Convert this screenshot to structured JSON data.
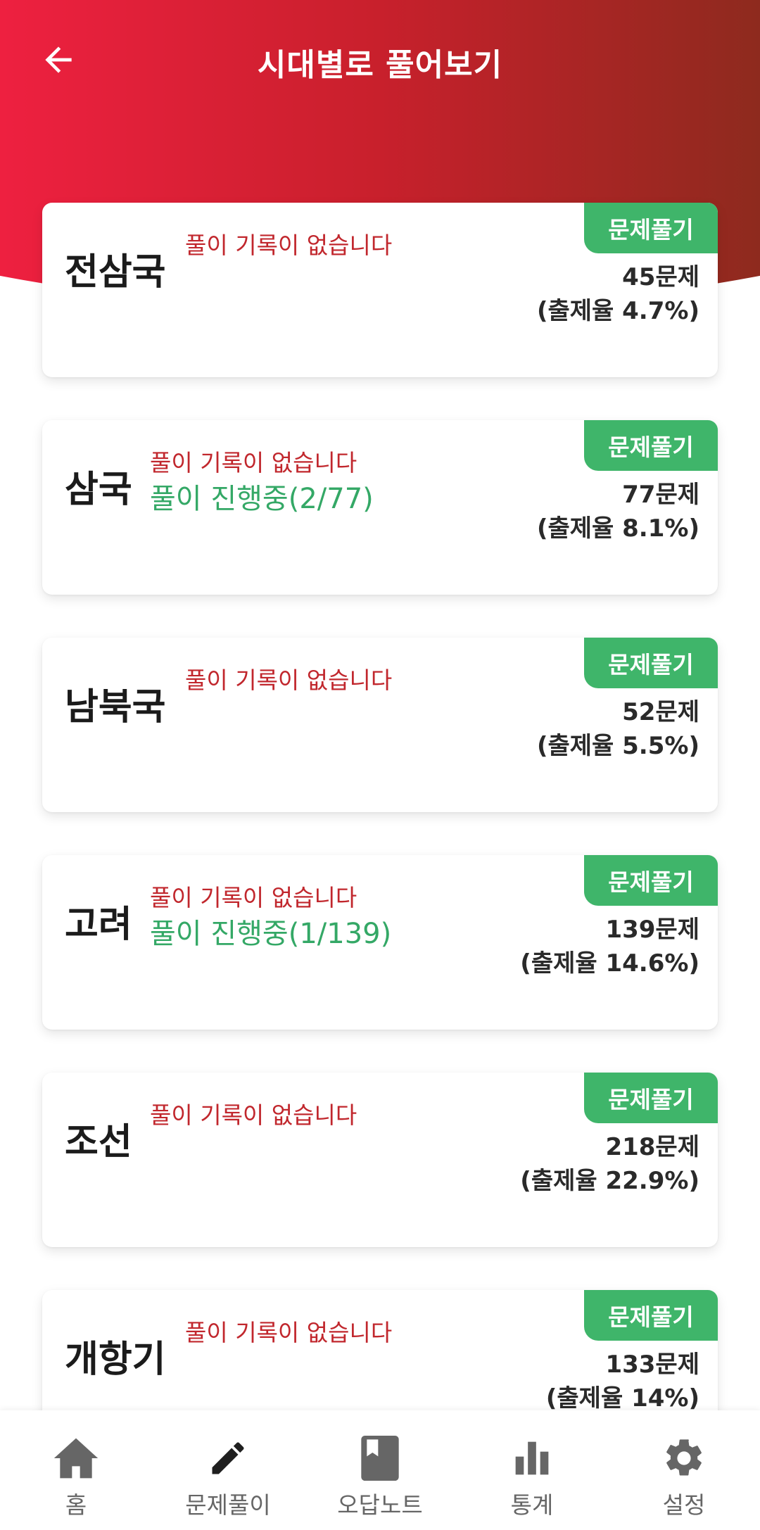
{
  "header": {
    "title": "시대별로 풀어보기",
    "back_icon": "arrow-left-icon",
    "gradient_colors": [
      "#ee2040",
      "#c8202c",
      "#8e2a1e"
    ]
  },
  "eras": [
    {
      "name": "전삼국",
      "status_none": "풀이 기록이 없습니다",
      "status_progress": "",
      "button": "문제풀기",
      "count": "45문제",
      "rate": "(출제율 4.7%)"
    },
    {
      "name": "삼국",
      "status_none": "풀이 기록이 없습니다",
      "status_progress": "풀이 진행중(2/77)",
      "button": "문제풀기",
      "count": "77문제",
      "rate": "(출제율 8.1%)"
    },
    {
      "name": "남북국",
      "status_none": "풀이 기록이 없습니다",
      "status_progress": "",
      "button": "문제풀기",
      "count": "52문제",
      "rate": "(출제율 5.5%)"
    },
    {
      "name": "고려",
      "status_none": "풀이 기록이 없습니다",
      "status_progress": "풀이 진행중(1/139)",
      "button": "문제풀기",
      "count": "139문제",
      "rate": "(출제율 14.6%)"
    },
    {
      "name": "조선",
      "status_none": "풀이 기록이 없습니다",
      "status_progress": "",
      "button": "문제풀기",
      "count": "218문제",
      "rate": "(출제율 22.9%)"
    },
    {
      "name": "개항기",
      "status_none": "풀이 기록이 없습니다",
      "status_progress": "",
      "button": "문제풀기",
      "count": "133문제",
      "rate": "(출제율 14%)"
    }
  ],
  "bottom_nav": [
    {
      "label": "홈",
      "icon": "home-icon"
    },
    {
      "label": "문제풀이",
      "icon": "pencil-icon"
    },
    {
      "label": "오답노트",
      "icon": "bookmark-book-icon"
    },
    {
      "label": "통계",
      "icon": "bar-chart-icon"
    },
    {
      "label": "설정",
      "icon": "gear-icon"
    }
  ],
  "colors": {
    "accent_red": "#c1272d",
    "progress_green": "#34a866",
    "button_green": "#3fb56a",
    "nav_gray": "#666666"
  }
}
